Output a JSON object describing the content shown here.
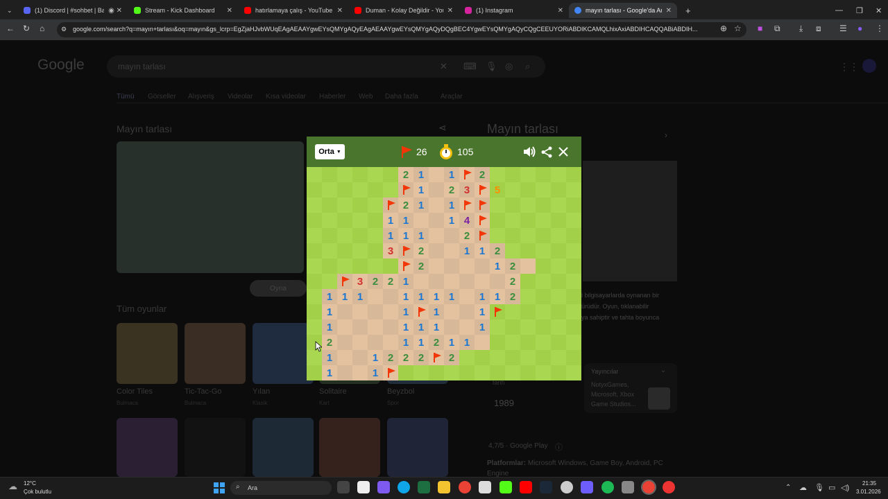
{
  "browser": {
    "tabs": [
      {
        "label": "(1) Discord | #sohbet | Bay",
        "color": "#5865f2"
      },
      {
        "label": "Stream - Kick Dashboard",
        "color": "#53fc18"
      },
      {
        "label": "hatırlamaya çalış - YouTube",
        "color": "#ff0000"
      },
      {
        "label": "Duman - Kolay Değildir - YouTu",
        "color": "#ff0000"
      },
      {
        "label": "(1) Instagram",
        "color": "#d6249f"
      },
      {
        "label": "mayın tarlası - Google'da Ara",
        "color": "#4285f4"
      }
    ],
    "url": "google.com/search?q=mayın+tarlası&oq=mayın&gs_lcrp=EgZjaHJvbWUqEAgAEAAYgwEYsQMYgAQyEAgAEAAYgwEYsQMYgAQyDQgBEC4YgwEYsQMYgAQyCQgCEEUYORiABDIKCAMQLhixAxiABDIHCAQQABiABDIH..."
  },
  "google": {
    "logo": "Google",
    "query": "mayın tarlası",
    "nav_tabs": [
      "Tümü",
      "Görseller",
      "Alışveriş",
      "Videolar",
      "Kısa videolar",
      "Haberler",
      "Web",
      "Daha fazla",
      "Araçlar"
    ],
    "panel_title": "Mayın tarlası",
    "side_title": "Mayın tarlası",
    "play_button": "Oyna",
    "games_heading": "Tüm oyunlar",
    "games": [
      {
        "name": "Color Tiles",
        "type": "Bulmaca"
      },
      {
        "name": "Tic-Tac-Go",
        "type": "Bulmaca"
      },
      {
        "name": "Yılan",
        "type": "Klasik"
      },
      {
        "name": "Solitaire",
        "type": "Kart"
      },
      {
        "name": "Beyzbol",
        "type": "Spor"
      }
    ],
    "side_text": [
      "i bilgisayarlarda oynanan bir",
      "ürüdür. Oyun, tıklanabilir",
      "ya sahiptir ve tahta boyunca"
    ],
    "publisher_label": "Yayıncılar",
    "publisher_value": [
      "NotyxGames,",
      "Microsoft, Xbox",
      "Game Studios..."
    ],
    "year_label": "tarih",
    "year": "1989",
    "rating": "4,7/5 · Google Play",
    "platforms_label": "Platformlar:",
    "platforms": "Microsoft Windows, Game Boy, Android, PC",
    "platforms_more": "Engine"
  },
  "game": {
    "difficulty": "Orta",
    "flags_left": "26",
    "time": "105",
    "number_colors": {
      "1": "#1976d2",
      "2": "#388e3c",
      "3": "#d32f2f",
      "4": "#7b1fa2",
      "5": "#ff8f00"
    },
    "rows": [
      "......21.1F2......",
      "......F1.23F5.....",
      ".....F21.1FF......",
      ".....11..14F......",
      ".....111..2F......",
      ".....3F2..112.....",
      "......F2....12....",
      "..F3221......2....",
      ".111..1111.112....",
      ".1....1F1..1F.....",
      ".1....111..1......",
      ".2....11211.......",
      ".1..1222F2........",
      ".1..1F............"
    ],
    "revealed": [
      "......xxxxxx......",
      "......xxxxxx......",
      ".....xxxxxxx......",
      ".....xxxxxxx......",
      ".....xxxxxxx......",
      ".....xxxxxxxx.....",
      "......xxxxxxxxx...",
      "..xxxxxxxxxxxx....",
      ".xxxxxxxxxxxxx....",
      ".xxxxxxxxxxx......",
      ".xxxxxxxxxxx......",
      ".xxxxxxxxxxx......",
      ".xxxxxxxxx........",
      ".xxxxx............"
    ]
  },
  "taskbar": {
    "temp": "12°C",
    "weather": "Çok bulutlu",
    "search": "Ara",
    "time": "21:35",
    "date": "3.01.2026"
  }
}
